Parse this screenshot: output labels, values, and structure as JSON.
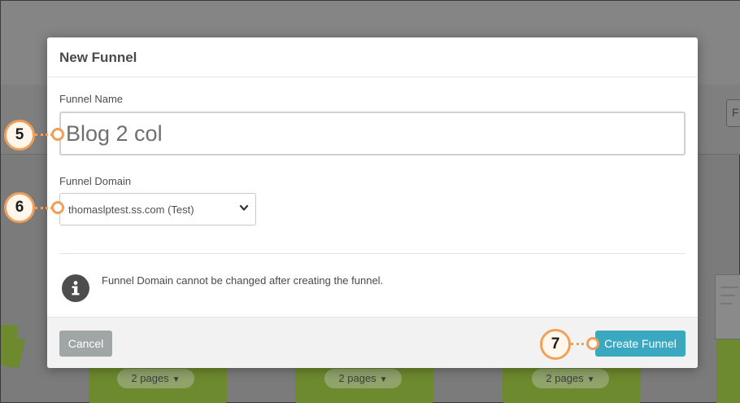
{
  "background": {
    "filter_hint": "F",
    "pages_pills": [
      {
        "label": "2 pages"
      },
      {
        "label": "2 pages"
      },
      {
        "label": "2 pages"
      }
    ]
  },
  "modal": {
    "title": "New Funnel",
    "funnel_name": {
      "label": "Funnel Name",
      "value": "Blog 2 col"
    },
    "funnel_domain": {
      "label": "Funnel Domain",
      "selected": "thomaslptest.ss.com (Test)"
    },
    "info_message": "Funnel Domain cannot be changed after creating the funnel.",
    "footer": {
      "cancel_label": "Cancel",
      "create_label": "Create Funnel"
    }
  },
  "annotations": {
    "step_name": "5",
    "step_domain": "6",
    "step_create": "7",
    "accent_color": "#f0a05a"
  },
  "colors": {
    "primary_button": "#3ba8c2",
    "cancel_button": "#a0a6a5",
    "background_green": "#6e8a2e"
  }
}
